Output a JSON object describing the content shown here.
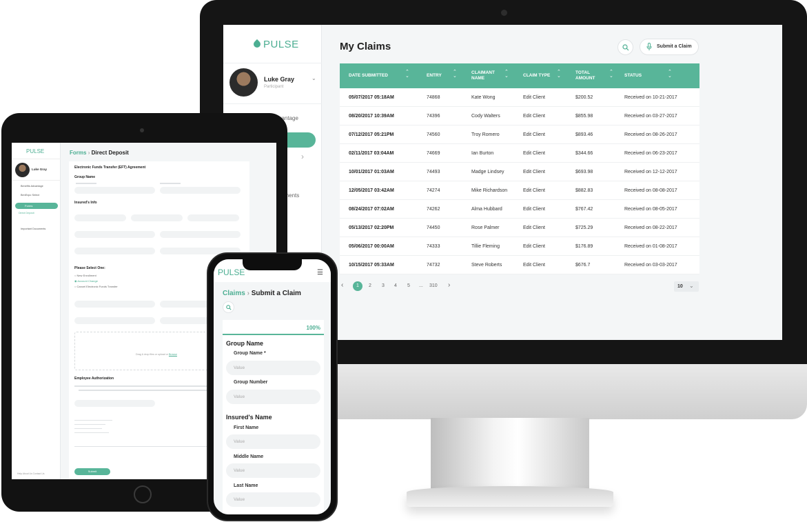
{
  "colors": {
    "accent": "#58b599",
    "brand": "#4cae92",
    "bezel": "#151515"
  },
  "brand": {
    "name": "PULSE"
  },
  "desktop": {
    "user": {
      "name": "Luke Gray",
      "role": "Participant"
    },
    "nav": {
      "item1": "dvantage",
      "active": "ct",
      "item2": "cuments"
    },
    "page_title": "My Claims",
    "submit_label": "Submit a Claim",
    "icons": {
      "search": "search-icon",
      "mic": "microphone-icon"
    },
    "table": {
      "headers": [
        "DATE SUBMITTED",
        "ENTRY",
        "CLAIMANT NAME",
        "CLAIM TYPE",
        "TOTAL AMOUNT",
        "STATUS"
      ],
      "rows": [
        [
          "05/07/2017  05:18AM",
          "74868",
          "Kate Wong",
          "Edit Client",
          "$200.52",
          "Received on 10-21-2017"
        ],
        [
          "08/20/2017  10:39AM",
          "74396",
          "Cody Walters",
          "Edit Client",
          "$855.98",
          "Received on 03-27-2017"
        ],
        [
          "07/12/2017  05:21PM",
          "74560",
          "Troy Romero",
          "Edit Client",
          "$893.46",
          "Received on 08-26-2017"
        ],
        [
          "02/11/2017  03:04AM",
          "74669",
          "Ian Burton",
          "Edit Client",
          "$344.66",
          "Received on 06-23-2017"
        ],
        [
          "10/01/2017  01:03AM",
          "74493",
          "Madge Lindsey",
          "Edit Client",
          "$693.98",
          "Received on 12-12-2017"
        ],
        [
          "12/05/2017  03:42AM",
          "74274",
          "Mike Richardson",
          "Edit Client",
          "$882.83",
          "Received on 08-08-2017"
        ],
        [
          "08/24/2017  07:02AM",
          "74262",
          "Alma Hubbard",
          "Edit Client",
          "$767.42",
          "Received on 08-05-2017"
        ],
        [
          "05/13/2017  02:20PM",
          "74450",
          "Rose Palmer",
          "Edit Client",
          "$725.29",
          "Received on 08-22-2017"
        ],
        [
          "05/06/2017  00:00AM",
          "74333",
          "Tillie Fleming",
          "Edit Client",
          "$176.89",
          "Received on 01-08-2017"
        ],
        [
          "10/15/2017  05:33AM",
          "74732",
          "Steve Roberts",
          "Edit Client",
          "$676.7",
          "Received on 03-03-2017"
        ]
      ]
    },
    "pagination": {
      "prev": "‹",
      "next": "›",
      "pages": [
        "1",
        "2",
        "3",
        "4",
        "5",
        "...",
        "310"
      ],
      "per_page": "10"
    }
  },
  "tablet": {
    "user": {
      "name": "Luke Gray"
    },
    "nav": [
      "Benefits Advantage",
      "BenExpo Select",
      "Forms",
      "Important Documents"
    ],
    "sub_nav": "Direct Deposit",
    "footer": "Help   About Us   Contact Us",
    "breadcrumb": {
      "parent": "Forms",
      "sep": "›",
      "current": "Direct Deposit"
    },
    "form": {
      "title": "Electronic Funds Transfer (EFT) Agreement",
      "group_heading": "Group Name",
      "insured_heading": "Insured's Info",
      "select_heading": "Please Select One:",
      "options": [
        "New Enrollment",
        "Account Change",
        "Cancel Electronic Funds Transfer"
      ],
      "auth_heading": "Employee Authorization",
      "drop_text": "Drag & drop files or upload or",
      "drop_link": "Browse",
      "submit": "Submit"
    }
  },
  "phone": {
    "breadcrumb": {
      "parent": "Claims",
      "sep": "›",
      "current": "Submit a Claim"
    },
    "progress": "100%",
    "sections": [
      {
        "title": "Group Name",
        "fields": [
          {
            "label": "Group Name *",
            "placeholder": "Value"
          },
          {
            "label": "Group Number",
            "placeholder": "Value"
          }
        ]
      },
      {
        "title": "Insured's Name",
        "fields": [
          {
            "label": "First Name",
            "placeholder": "Value"
          },
          {
            "label": "Middle Name",
            "placeholder": "Value"
          },
          {
            "label": "Last Name",
            "placeholder": "Value"
          }
        ]
      }
    ]
  }
}
